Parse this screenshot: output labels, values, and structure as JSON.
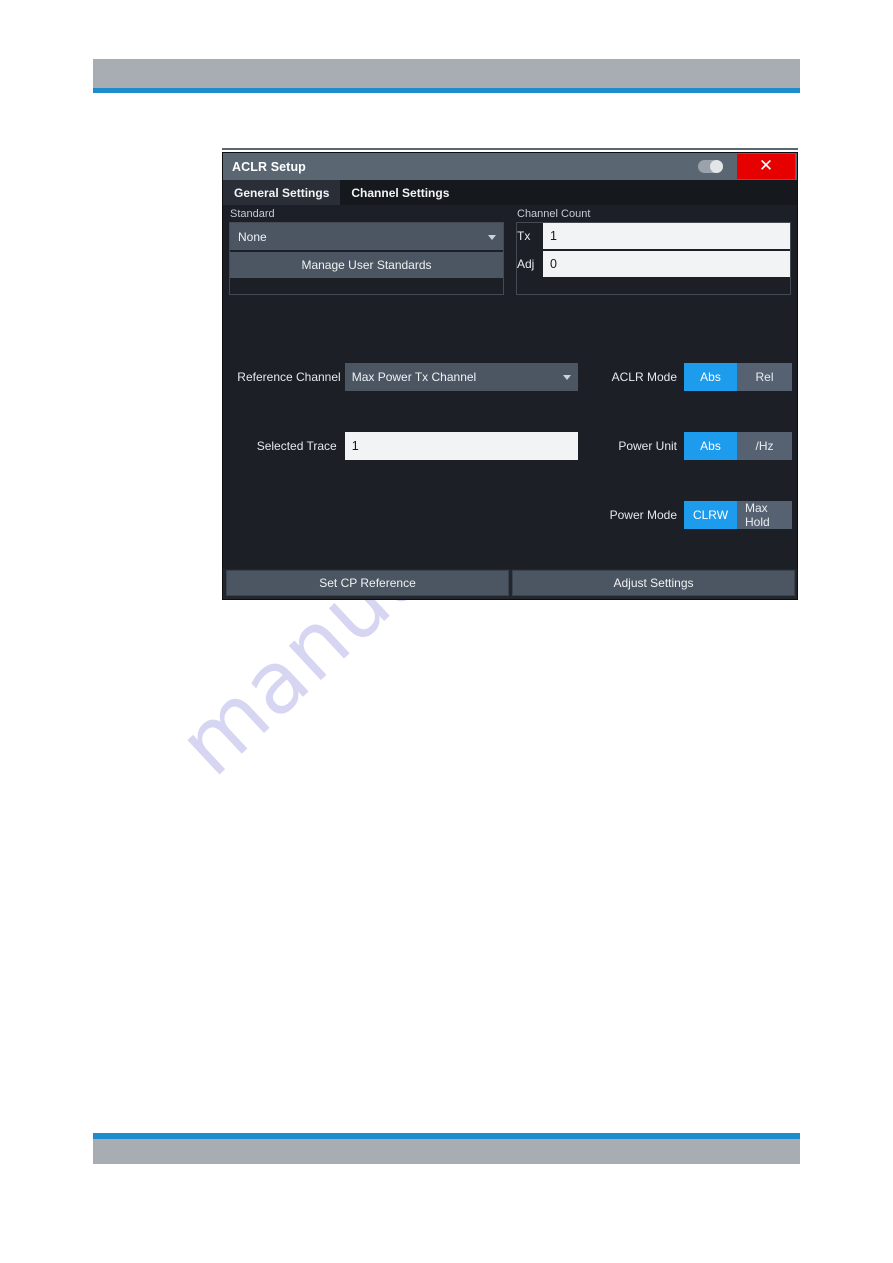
{
  "watermark": {
    "text": "manualshive.com"
  },
  "dialog": {
    "title": "ACLR Setup",
    "titlebar": {
      "toggle_name": "on-off-toggle",
      "close_label": "✕"
    },
    "tabs": [
      {
        "label": "General Settings",
        "active": true
      },
      {
        "label": "Channel Settings",
        "active": false
      }
    ],
    "groups": {
      "standard": {
        "label": "Standard",
        "combo_value": "None",
        "manage_button": "Manage User Standards"
      },
      "channel_count": {
        "label": "Channel Count",
        "rows": [
          {
            "label": "Tx",
            "value": "1"
          },
          {
            "label": "Adj",
            "value": "0"
          }
        ]
      }
    },
    "controls": {
      "reference_channel": {
        "label": "Reference Channel",
        "value": "Max Power Tx Channel"
      },
      "selected_trace": {
        "label": "Selected Trace",
        "value": "1"
      },
      "aclr_mode": {
        "label": "ACLR Mode",
        "options": [
          "Abs",
          "Rel"
        ],
        "selected": "Abs"
      },
      "power_unit": {
        "label": "Power Unit",
        "options": [
          "Abs",
          "/Hz"
        ],
        "selected": "Abs"
      },
      "power_mode": {
        "label": "Power Mode",
        "options": [
          "CLRW",
          "Max Hold"
        ],
        "selected": "CLRW"
      }
    },
    "footer_buttons": [
      {
        "label": "Set CP Reference"
      },
      {
        "label": "Adjust Settings"
      }
    ]
  },
  "colors": {
    "accent_blue": "#1d9bec",
    "rule_blue": "#1e8bcd",
    "bar_gray": "#a7adb3",
    "titlebar_gray": "#5a6672",
    "close_red": "#e60000",
    "dialog_bg": "#1c2026"
  }
}
